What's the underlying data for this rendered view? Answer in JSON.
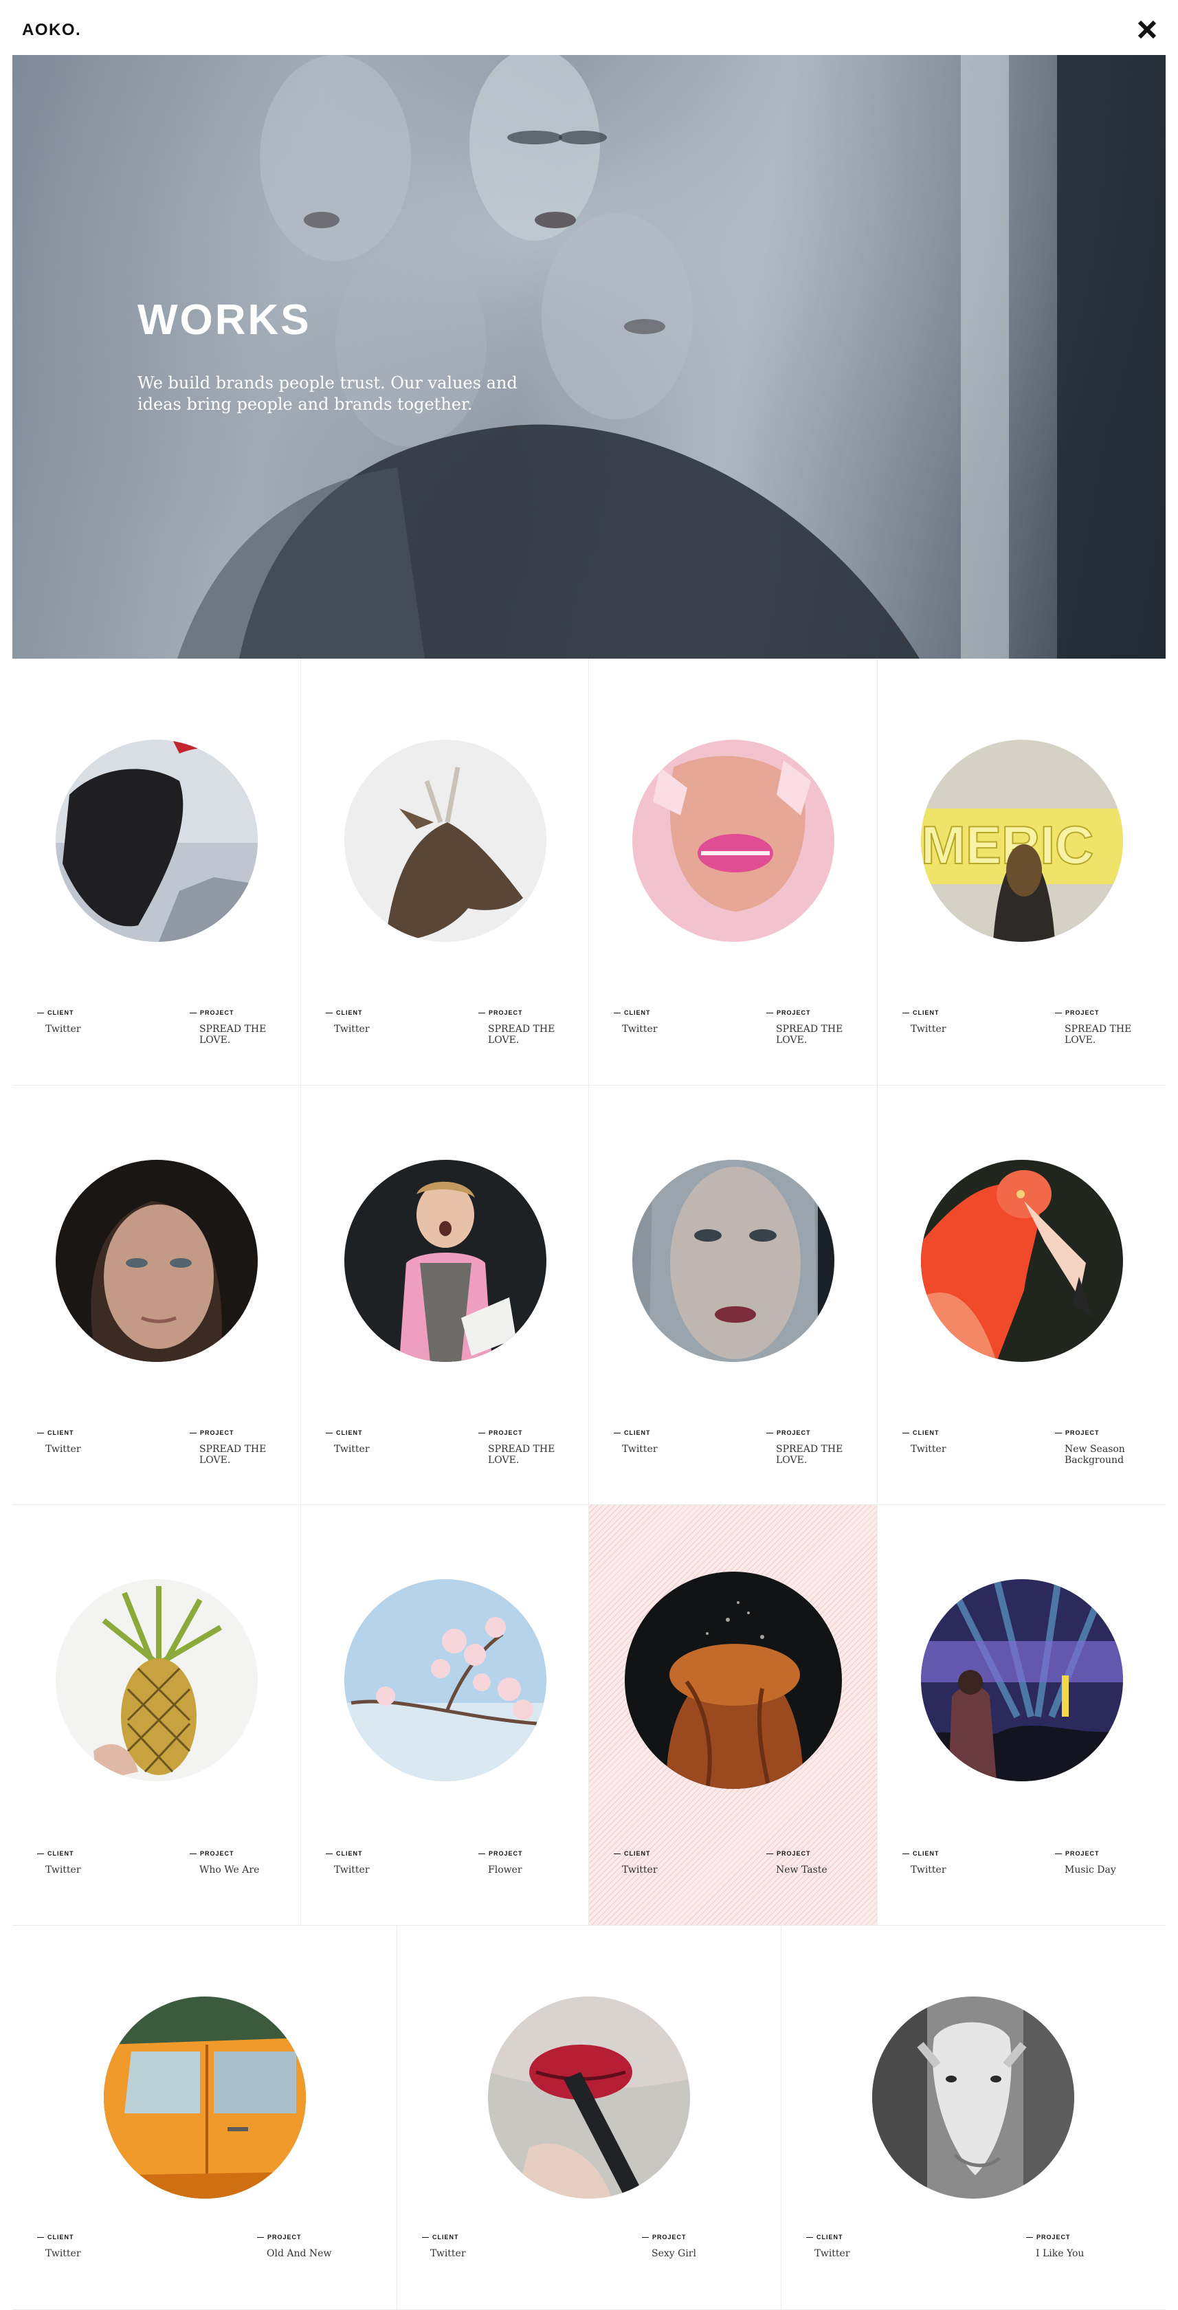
{
  "header": {
    "logo": "AOKO.",
    "close_icon": "close-icon"
  },
  "hero": {
    "title": "WORKS",
    "description": "We build brands people trust. Our values and ideas bring people and brands together."
  },
  "labels": {
    "client": "CLIENT",
    "project": "PROJECT"
  },
  "works": [
    {
      "client": "Twitter",
      "project": "SPREAD THE LOVE.",
      "image": "hooded-figure-clouds"
    },
    {
      "client": "Twitter",
      "project": "SPREAD THE LOVE.",
      "image": "deer-head"
    },
    {
      "client": "Twitter",
      "project": "SPREAD THE LOVE.",
      "image": "pink-lips-torn-paper"
    },
    {
      "client": "Twitter",
      "project": "SPREAD THE LOVE.",
      "image": "neon-sign-woman"
    },
    {
      "client": "Twitter",
      "project": "SPREAD THE LOVE.",
      "image": "woman-portrait"
    },
    {
      "client": "Twitter",
      "project": "SPREAD THE LOVE.",
      "image": "surprised-boy-book"
    },
    {
      "client": "Twitter",
      "project": "SPREAD THE LOVE.",
      "image": "woman-face-closeup"
    },
    {
      "client": "Twitter",
      "project": "New Season Background",
      "image": "flamingo"
    },
    {
      "client": "Twitter",
      "project": "Who We Are",
      "image": "pineapple-face"
    },
    {
      "client": "Twitter",
      "project": "Flower",
      "image": "cherry-blossom"
    },
    {
      "client": "Twitter",
      "project": "New Taste",
      "image": "baked-bread"
    },
    {
      "client": "Twitter",
      "project": "Music Day",
      "image": "concert-crowd"
    },
    {
      "client": "Twitter",
      "project": "Old And New",
      "image": "orange-car"
    },
    {
      "client": "Twitter",
      "project": "Sexy Girl",
      "image": "red-lipstick"
    },
    {
      "client": "Twitter",
      "project": "I Like You",
      "image": "goat"
    }
  ],
  "colors": {
    "accent_stripe": "#f3c9c9",
    "grid_border": "#ececec"
  }
}
